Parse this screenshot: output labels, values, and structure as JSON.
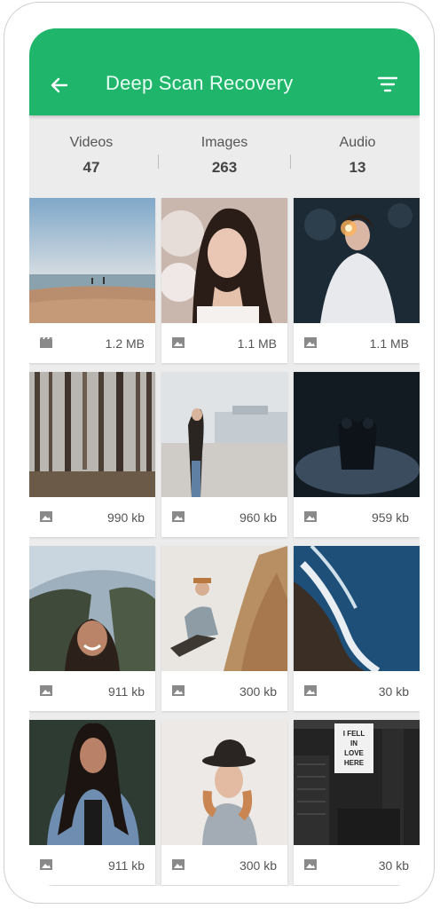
{
  "header": {
    "title": "Deep Scan Recovery"
  },
  "stats": [
    {
      "label": "Videos",
      "value": "47"
    },
    {
      "label": "Images",
      "value": "263"
    },
    {
      "label": "Audio",
      "value": "13"
    }
  ],
  "icons": {
    "back": "back-arrow-icon",
    "filter": "filter-icon",
    "image": "image-icon",
    "video": "video-icon"
  },
  "colors": {
    "accent": "#1fb56b",
    "background": "#ececec"
  },
  "items": [
    {
      "size": "1.2 MB",
      "type": "video"
    },
    {
      "size": "1.1 MB",
      "type": "image"
    },
    {
      "size": "1.1 MB",
      "type": "image"
    },
    {
      "size": "990 kb",
      "type": "image"
    },
    {
      "size": "960 kb",
      "type": "image"
    },
    {
      "size": "959 kb",
      "type": "image"
    },
    {
      "size": "911 kb",
      "type": "image"
    },
    {
      "size": "300 kb",
      "type": "image"
    },
    {
      "size": "30 kb",
      "type": "image"
    },
    {
      "size": "911 kb",
      "type": "image"
    },
    {
      "size": "300 kb",
      "type": "image"
    },
    {
      "size": "30 kb",
      "type": "image"
    }
  ],
  "sign_text": "I FELL IN LOVE HERE"
}
